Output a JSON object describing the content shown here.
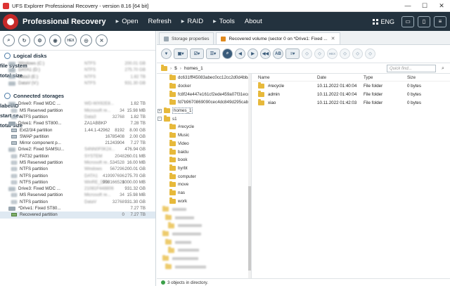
{
  "window": {
    "title": "UFS Explorer Professional Recovery - version 8.16 [64 bit]",
    "min": "—",
    "max": "☐",
    "close": "✕"
  },
  "header": {
    "brand": "Professional Recovery",
    "menu": [
      "Open",
      "Refresh",
      "RAID",
      "Tools",
      "About"
    ],
    "language": "ENG",
    "accent": "#23323e"
  },
  "left_toolbar": {
    "buttons": [
      "search",
      "refresh",
      "settings",
      "disk",
      "HEX",
      "view",
      "close"
    ]
  },
  "logical_disks": {
    "title": "Logical disks",
    "columns": [
      "file system",
      "total size"
    ],
    "items": [
      {
        "name": "Windows (C:)",
        "fs": "NTFS",
        "size": "200.01 GB"
      },
      {
        "name": "DATA1 (D:)",
        "fs": "NTFS",
        "size": "275.70 GB"
      },
      {
        "name": "Data3 (E:)",
        "fs": "NTFS",
        "size": "1.82 TB"
      },
      {
        "name": "DataV (V:)",
        "fs": "NTFS",
        "size": "931.30 GB"
      }
    ]
  },
  "connected_storages": {
    "title": "Connected storages",
    "columns": [
      "label/ID",
      "start se...",
      "total size"
    ],
    "items": [
      {
        "kind": "drive",
        "name": "Drive0: Fixed WDC ...",
        "label": "WD-WX92E8...",
        "start": "",
        "size": "1.82 TB",
        "blur": true
      },
      {
        "kind": "part",
        "name": "MS Reserved partition",
        "label": "Microsoft re...",
        "start": "34",
        "size": "15.98 MB",
        "blur": true
      },
      {
        "kind": "part",
        "name": "NTFS partition",
        "label": "Data3",
        "start": "32768",
        "size": "1.82 TB",
        "blur": true
      },
      {
        "kind": "drive",
        "name": "Drive1: Fixed ST800...",
        "label": "ZA1ABBKP",
        "start": "",
        "size": "7.28 TB",
        "blur": false
      },
      {
        "kind": "part",
        "name": "Ext2/3/4 partition",
        "label": "1.44.1-42962",
        "start": "8192",
        "size": "8.00 GB",
        "blur": false
      },
      {
        "kind": "part",
        "name": "SWAP partition",
        "label": "",
        "start": "16785408",
        "size": "2.00 GB",
        "blur": false
      },
      {
        "kind": "part",
        "name": "Mirror component p...",
        "label": "",
        "start": "21243904",
        "size": "7.27 TB",
        "blur": false
      },
      {
        "kind": "drive",
        "name": "Drive2: Fixed SAMSU...",
        "label": "S4NN0F0K24...",
        "start": "",
        "size": "476.94 GB",
        "blur": true
      },
      {
        "kind": "part",
        "name": "FAT32 partition",
        "label": "SYSTEM",
        "start": "2048",
        "size": "260.01 MB",
        "blur": true
      },
      {
        "kind": "part",
        "name": "MS Reserved partition",
        "label": "Microsoft re...",
        "start": "534528",
        "size": "16.00 MB",
        "blur": true
      },
      {
        "kind": "part",
        "name": "NTFS partition",
        "label": "Windows",
        "start": "567296",
        "size": "200.01 GB",
        "blur": true
      },
      {
        "kind": "part",
        "name": "NTFS partition",
        "label": "DATA1",
        "start": "419997696",
        "size": "275.70 GB",
        "blur": true
      },
      {
        "kind": "part",
        "name": "NTFS partition",
        "label": "WinRE_DRV",
        "start": "998166528",
        "size": "1000.00 MB",
        "blur": true
      },
      {
        "kind": "drive",
        "name": "Drive3: Fixed WDC ...",
        "label": "21081F448806",
        "start": "",
        "size": "931.32 GB",
        "blur": true
      },
      {
        "kind": "part",
        "name": "MS Reserved partition",
        "label": "Microsoft re...",
        "start": "34",
        "size": "15.98 MB",
        "blur": true
      },
      {
        "kind": "part",
        "name": "NTFS partition",
        "label": "DataV",
        "start": "32768",
        "size": "931.30 GB",
        "blur": true
      },
      {
        "kind": "drive",
        "name": "*Drive1: Fixed ST80...",
        "label": "",
        "start": "",
        "size": "7.27 TB",
        "blur": false
      },
      {
        "kind": "recovered",
        "name": "Recovered partition",
        "label": "",
        "start": "0",
        "size": "7.27 TB",
        "blur": false
      }
    ]
  },
  "tabs": [
    {
      "label": "Storage properties",
      "active": false
    },
    {
      "label": "Recovered volume (sector 0 on *Drive1: Fixed ...",
      "active": true
    }
  ],
  "right_toolbar": {
    "buttons": [
      "check",
      "save",
      "save-menu",
      "select",
      "select-menu",
      "view",
      "view-menu",
      "find",
      "back",
      "forward",
      "scan-back",
      "AB",
      "filter",
      "dis1",
      "dis2",
      "HEX",
      "dis3",
      "dis4",
      "dis5"
    ]
  },
  "path": {
    "root": "$",
    "current": "homes_1",
    "quick_find_placeholder": "Quick find..."
  },
  "tree": [
    {
      "level": 1,
      "label": "dc631fff45083abec0cc12cc2d0d4bbab",
      "expand": ""
    },
    {
      "level": 1,
      "label": "docker",
      "expand": ""
    },
    {
      "level": 1,
      "label": "fc8f24e447e161cf2ede459a07f31ecd6",
      "expand": ""
    },
    {
      "level": 1,
      "label": "fd7b9670869090cec4dc849d295cab92",
      "expand": ""
    },
    {
      "level": 0,
      "label": "homes_1",
      "expand": "+",
      "selected": true
    },
    {
      "level": 0,
      "label": "s1",
      "expand": "-"
    },
    {
      "level": 1,
      "label": "#recycle",
      "expand": ""
    },
    {
      "level": 1,
      "label": "Music",
      "expand": ""
    },
    {
      "level": 1,
      "label": "Video",
      "expand": ""
    },
    {
      "level": 1,
      "label": "baidu",
      "expand": ""
    },
    {
      "level": 1,
      "label": "book",
      "expand": ""
    },
    {
      "level": 1,
      "label": "byrbt",
      "expand": ""
    },
    {
      "level": 1,
      "label": "computer",
      "expand": ""
    },
    {
      "level": 1,
      "label": "move",
      "expand": ""
    },
    {
      "level": 1,
      "label": "nas",
      "expand": ""
    },
    {
      "level": 1,
      "label": "work",
      "expand": ""
    }
  ],
  "list": {
    "columns": [
      "Name",
      "Date",
      "Type",
      "Size"
    ],
    "rows": [
      {
        "name": "#recycle",
        "date": "10.11.2022 01:40:04",
        "type": "File folder",
        "size": "0 bytes"
      },
      {
        "name": "admin",
        "date": "10.11.2022 01:40:04",
        "type": "File folder",
        "size": "0 bytes"
      },
      {
        "name": "xiao",
        "date": "10.11.2022 01:42:03",
        "type": "File folder",
        "size": "0 bytes"
      }
    ]
  },
  "status": {
    "text": "3 objects in directory."
  }
}
